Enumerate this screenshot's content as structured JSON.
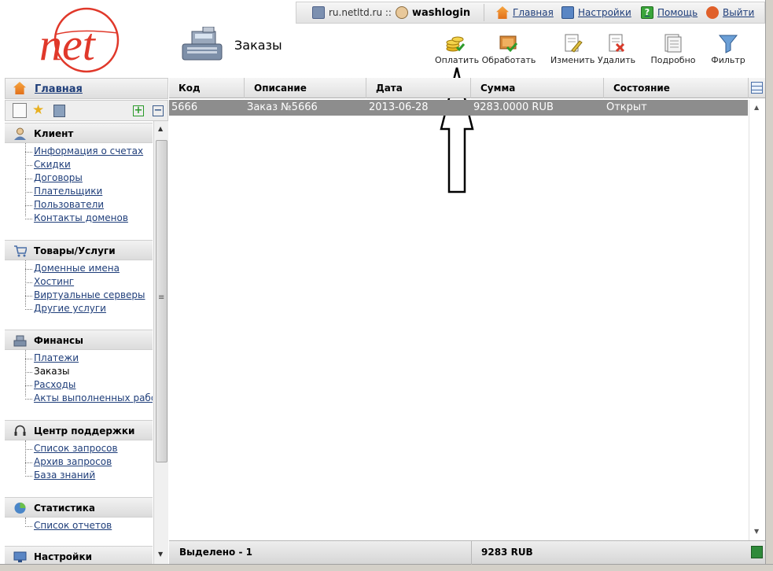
{
  "header": {
    "site": "ru.netltd.ru ::",
    "username": "washlogin",
    "links": [
      {
        "label": "Главная",
        "icon": "home-icon"
      },
      {
        "label": "Настройки",
        "icon": "settings-monitor-icon"
      },
      {
        "label": "Помощь",
        "icon": "help-icon"
      },
      {
        "label": "Выйти",
        "icon": "power-icon"
      }
    ]
  },
  "logo": {
    "text": "net"
  },
  "page": {
    "title": "Заказы"
  },
  "toolbar": {
    "pay": "Оплатить",
    "process": "Обработать",
    "edit": "Изменить",
    "delete": "Удалить",
    "details": "Подробно",
    "filter": "Фильтр"
  },
  "sidebar": {
    "home": "Главная",
    "sections": [
      {
        "title": "Клиент",
        "icon": "client-icon",
        "items": [
          "Информация о счетах",
          "Скидки",
          "Договоры",
          "Плательщики",
          "Пользователи",
          "Контакты доменов"
        ]
      },
      {
        "title": "Товары/Услуги",
        "icon": "cart-icon",
        "items": [
          "Доменные имена",
          "Хостинг",
          "Виртуальные серверы",
          "Другие услуги"
        ]
      },
      {
        "title": "Финансы",
        "icon": "cash-register-icon",
        "items": [
          "Платежи",
          "Заказы",
          "Расходы",
          "Акты выполненных работ"
        ]
      },
      {
        "title": "Центр поддержки",
        "icon": "headset-icon",
        "items": [
          "Список запросов",
          "Архив запросов",
          "База знаний"
        ]
      },
      {
        "title": "Статистика",
        "icon": "pie-chart-icon",
        "items": [
          "Список отчетов"
        ]
      },
      {
        "title": "Настройки",
        "icon": "settings-monitor-icon",
        "items": []
      }
    ]
  },
  "grid": {
    "columns": [
      "Код",
      "Описание",
      "Дата",
      "Сумма",
      "Состояние"
    ],
    "rows": [
      [
        "5666",
        "Заказ №5666",
        "2013-06-28",
        "9283.0000 RUB",
        "Открыт"
      ]
    ],
    "footer": {
      "selected": "Выделено - 1",
      "total": "9283 RUB"
    }
  },
  "colors": {
    "link": "#1f3e7a",
    "logo_red": "#e0382a",
    "selected_row": "#8d8d8d"
  }
}
